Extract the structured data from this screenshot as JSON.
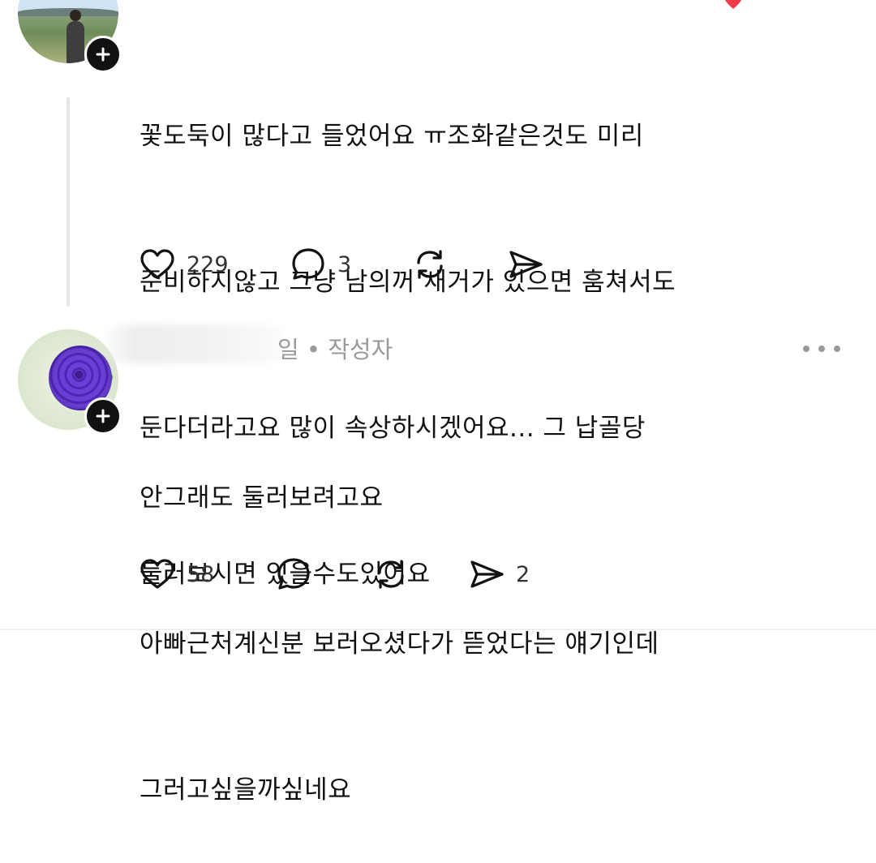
{
  "comments": [
    {
      "lines": [
        "꽃도둑이 많다고 들었어요 ㅠ조화같은것도 미리",
        "준비하지않고 그냥 남의꺼 새거가 있으면 훔쳐서도",
        "둔다더라고요 많이 속상하시겠어요... 그 납골당",
        "둘러보시면 있을수도있어요"
      ],
      "like_count": "229",
      "reply_count": "3"
    },
    {
      "meta": "일 • 작성자",
      "lines": [
        "안그래도 둘러보려고요",
        "아빠근처계신분 보러오셨다가 뜯었다는 얘기인데",
        "그러고싶을까싶네요"
      ],
      "like_count": "58",
      "share_count": "2"
    }
  ],
  "icons": {
    "like": "heart-icon",
    "reply": "comment-bubble-icon",
    "repost": "repost-icon",
    "share": "send-icon",
    "follow": "plus-icon",
    "more": "more-options-icon"
  },
  "colors": {
    "text": "#111111",
    "muted": "#9a9a9a",
    "badge": "#111111",
    "thread_line": "#e6e6e6"
  }
}
